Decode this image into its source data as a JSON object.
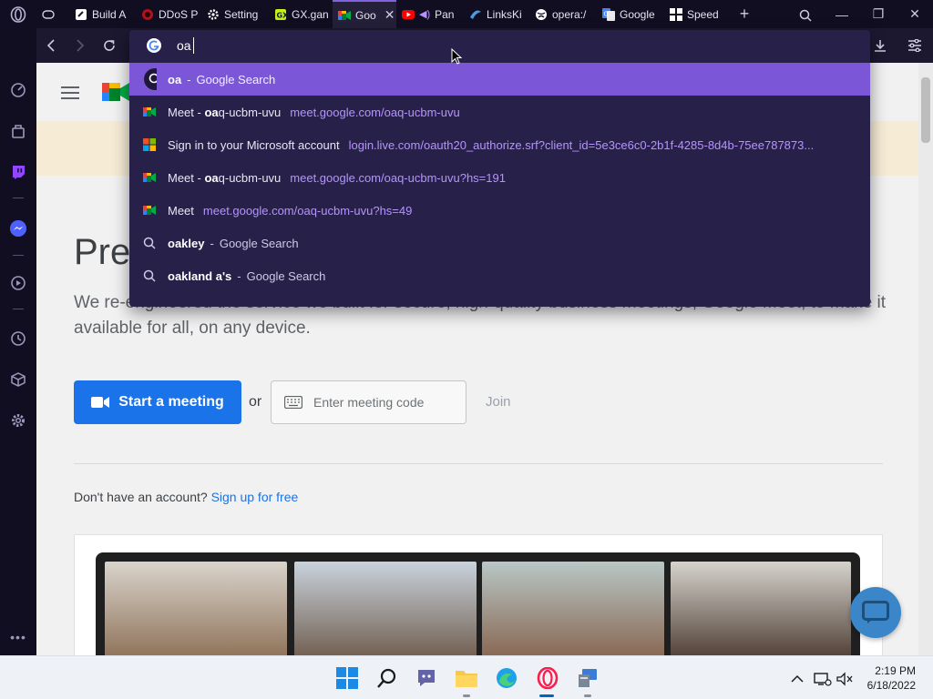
{
  "browser": {
    "tabs": [
      {
        "title": "Build A",
        "icon": "build-icon",
        "active": false
      },
      {
        "title": "DDoS P",
        "icon": "ddos-icon",
        "active": false
      },
      {
        "title": "Setting",
        "icon": "gear-icon",
        "active": false
      },
      {
        "title": "GX.gan",
        "icon": "gx-games-icon",
        "active": false
      },
      {
        "title": "Goo",
        "icon": "meet-icon",
        "active": true
      },
      {
        "title": "Pan",
        "icon": "youtube-icon",
        "active": false
      },
      {
        "title": "LinksKi",
        "icon": "linkski-icon",
        "active": false
      },
      {
        "title": "opera:/",
        "icon": "globe-icon",
        "active": false
      },
      {
        "title": "Google",
        "icon": "google-translate-icon",
        "active": false
      },
      {
        "title": "Speed",
        "icon": "speed-dial-icon",
        "active": false
      }
    ],
    "new_tab": "+",
    "address": {
      "typed": "oa"
    },
    "suggestions": [
      {
        "kind": "search",
        "bold": "oa",
        "rest": "",
        "engine": "Google Search",
        "selected": true
      },
      {
        "kind": "meet",
        "prefix": "Meet - ",
        "bold": "oa",
        "rest": "q-ucbm-uvu",
        "url": "meet.google.com/oaq-ucbm-uvu"
      },
      {
        "kind": "microsoft",
        "prefix": "Sign in to your Microsoft account",
        "bold": "",
        "rest": "",
        "url": "login.live.com/oauth20_authorize.srf?client_id=5e3ce6c0-2b1f-4285-8d4b-75ee787873..."
      },
      {
        "kind": "meet",
        "prefix": "Meet - ",
        "bold": "oa",
        "rest": "q-ucbm-uvu",
        "url": "meet.google.com/oaq-ucbm-uvu?hs=191"
      },
      {
        "kind": "meet",
        "prefix": "Meet",
        "bold": "",
        "rest": "",
        "url": "meet.google.com/oaq-ucbm-uvu?hs=49"
      },
      {
        "kind": "search",
        "bold": "oa",
        "rest": "kley",
        "engine": "Google Search"
      },
      {
        "kind": "search",
        "bold": "oa",
        "rest": "kland a's",
        "engine": "Google Search"
      }
    ]
  },
  "page": {
    "title_partial": "Pre",
    "description": "We re-engineered the service we built for secure, high-quality business meetings, Google Meet, to make it available for all, on any device.",
    "start_meeting": "Start a meeting",
    "or": "or",
    "code_placeholder": "Enter meeting code",
    "join": "Join",
    "no_account": "Don't have an account?",
    "signup": "Sign up for free"
  },
  "taskbar": {
    "time": "2:19 PM",
    "date": "6/18/2022"
  },
  "colors": {
    "accent": "#7b57d8",
    "meet_blue": "#1a73e8",
    "url_purple": "#b593ff"
  }
}
